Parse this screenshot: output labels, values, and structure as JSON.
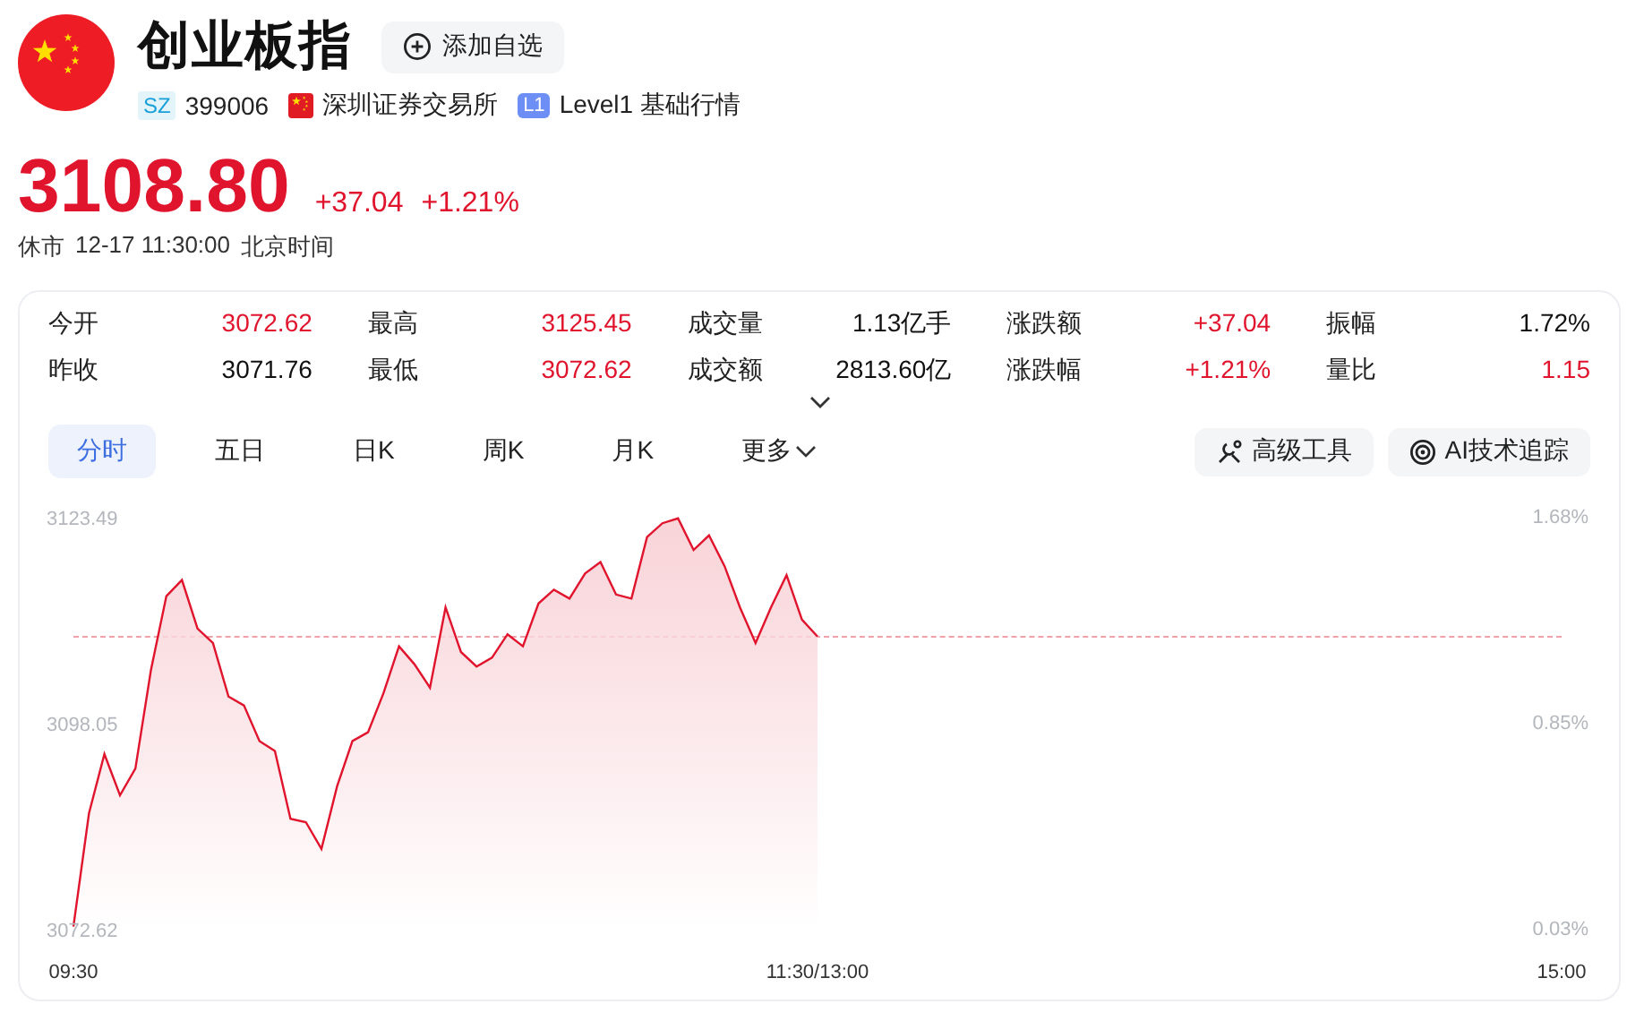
{
  "header": {
    "title": "创业板指",
    "watch_button": "添加自选"
  },
  "info": {
    "market_badge": "SZ",
    "code": "399006",
    "exchange": "深圳证券交易所",
    "level_badge": "L1",
    "level": "Level1 基础行情"
  },
  "quote": {
    "up": true,
    "price": "3108.80",
    "change": "+37.04",
    "change_pct": "+1.21%",
    "status": "休市",
    "time": "12-17 11:30:00",
    "timezone": "北京时间"
  },
  "stats": [
    {
      "label": "今开",
      "value": "3072.62",
      "up": true
    },
    {
      "label": "最高",
      "value": "3125.45",
      "up": true
    },
    {
      "label": "成交量",
      "value": "1.13亿手",
      "up": false
    },
    {
      "label": "涨跌额",
      "value": "+37.04",
      "up": true
    },
    {
      "label": "振幅",
      "value": "1.72%",
      "up": false
    },
    {
      "label": "昨收",
      "value": "3071.76",
      "up": false
    },
    {
      "label": "最低",
      "value": "3072.62",
      "up": true
    },
    {
      "label": "成交额",
      "value": "2813.60亿",
      "up": false
    },
    {
      "label": "涨跌幅",
      "value": "+1.21%",
      "up": true
    },
    {
      "label": "量比",
      "value": "1.15",
      "up": true
    }
  ],
  "stats_expanded": false,
  "tabs": [
    {
      "label": "分时",
      "kind": "tab",
      "selected": true
    },
    {
      "label": "五日",
      "kind": "tab",
      "selected": false
    },
    {
      "label": "日K",
      "kind": "tab",
      "selected": false
    },
    {
      "label": "周K",
      "kind": "tab",
      "selected": false
    },
    {
      "label": "月K",
      "kind": "tab",
      "selected": false
    },
    {
      "label": "更多",
      "kind": "menu",
      "selected": false
    }
  ],
  "tools": [
    {
      "label": "高级工具",
      "kind": "tools"
    },
    {
      "label": "AI技术追踪",
      "kind": "ai"
    }
  ],
  "chart": {
    "right_labels": [
      "1.68%",
      "0.85%",
      "0.03%"
    ],
    "chart_data": {
      "type": "area",
      "ylim": [
        3072.62,
        3123.49
      ],
      "yticks": [
        3123.49,
        3098.05,
        3072.62
      ],
      "categories": [
        "09:30",
        null,
        null,
        null,
        null,
        null,
        null,
        null,
        null,
        null,
        null,
        null,
        null,
        null,
        null,
        null,
        null,
        null,
        null,
        null,
        null,
        null,
        null,
        null,
        null,
        null,
        null,
        null,
        null,
        null,
        null,
        null,
        null,
        null,
        null,
        null,
        null,
        null,
        null,
        null,
        null,
        null,
        null,
        null,
        null,
        null,
        null,
        null,
        "11:30/13:00",
        null,
        null,
        null,
        null,
        null,
        null,
        null,
        null,
        null,
        null,
        null,
        null,
        null,
        null,
        null,
        null,
        null,
        null,
        null,
        null,
        null,
        null,
        null,
        null,
        null,
        null,
        null,
        null,
        null,
        null,
        null,
        null,
        null,
        null,
        null,
        null,
        null,
        null,
        null,
        null,
        null,
        null,
        null,
        null,
        null,
        null,
        null,
        "15:00"
      ],
      "series": [
        {
          "color": "#e0142c",
          "values": [
            3073.0,
            3087.0,
            3094.3,
            3089.2,
            3092.5,
            3104.7,
            3113.8,
            3115.8,
            3109.8,
            3108.0,
            3101.4,
            3100.3,
            3095.9,
            3094.7,
            3086.3,
            3085.9,
            3082.6,
            3090.3,
            3095.9,
            3097.0,
            3101.8,
            3107.6,
            3105.4,
            3102.5,
            3112.4,
            3106.9,
            3105.1,
            3106.2,
            3109.1,
            3107.6,
            3112.9,
            3114.6,
            3113.5,
            3116.6,
            3118.0,
            3114.0,
            3113.5,
            3121.1,
            3122.8,
            3123.4,
            3119.5,
            3121.3,
            3117.5,
            3112.4,
            3108.0,
            3112.4,
            3116.4,
            3110.9,
            3108.8,
            null,
            null,
            null,
            null,
            null,
            null,
            null,
            null,
            null,
            null,
            null,
            null,
            null,
            null,
            null,
            null,
            null,
            null,
            null,
            null,
            null,
            null,
            null,
            null,
            null,
            null,
            null,
            null,
            null,
            null,
            null,
            null,
            null,
            null,
            null,
            null,
            null,
            null,
            null,
            null,
            null,
            null,
            null,
            null,
            null,
            null,
            null,
            null
          ]
        }
      ]
    }
  }
}
